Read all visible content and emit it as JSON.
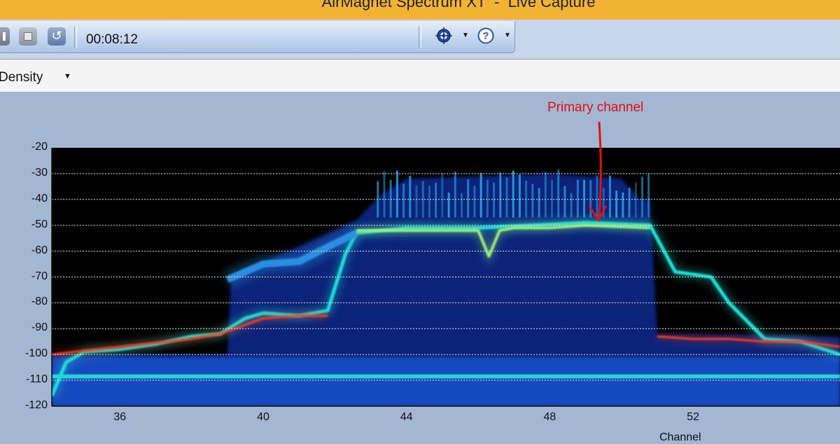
{
  "window": {
    "title": "AirMagnet Spectrum XT  -  Live Capture"
  },
  "toolbar": {
    "elapsed_time": "00:08:12",
    "buttons": [
      {
        "name": "pause-button",
        "icon": "pause-icon"
      },
      {
        "name": "stop-button",
        "icon": "stop-icon"
      },
      {
        "name": "refresh-button",
        "icon": "refresh-icon"
      },
      {
        "name": "locate-button",
        "icon": "crosshair-icon"
      },
      {
        "name": "help-button",
        "icon": "help-icon"
      }
    ]
  },
  "view": {
    "selected": "Density"
  },
  "annotation": {
    "label": "Primary channel",
    "color": "#e01010"
  },
  "colors": {
    "plot_bg": "#000000",
    "window_bg": "#a3b6d2",
    "titlebar": "#f2b233"
  },
  "chart_data": {
    "type": "heatmap",
    "title": "",
    "xlabel": "Channel",
    "ylabel": "",
    "x_ticks": [
      36,
      40,
      44,
      48,
      52
    ],
    "y_ticks": [
      -20,
      -30,
      -40,
      -50,
      -60,
      -70,
      -80,
      -90,
      -100,
      -110,
      -120
    ],
    "ylim": [
      -120,
      -20
    ],
    "grid": true,
    "x_range": [
      34.1,
      56.1
    ],
    "traces": [
      {
        "name": "noise-floor",
        "x": [
          34.1,
          36,
          38,
          40,
          42,
          44,
          46,
          48,
          50,
          52,
          54,
          56.1
        ],
        "y": [
          -108,
          -108,
          -108,
          -109,
          -108,
          -108,
          -108,
          -109,
          -108,
          -108,
          -108,
          -109
        ],
        "color": "#2fd0d0",
        "width": 16
      },
      {
        "name": "wide-band-edge",
        "x": [
          34.1,
          34.5,
          35,
          36,
          37,
          38,
          38.8,
          39.5,
          40,
          41,
          41.8,
          42.3,
          42.6,
          44,
          46,
          47.5,
          49,
          50.8,
          51.5,
          52.5,
          53,
          54,
          55,
          56.1
        ],
        "y": [
          -116,
          -103,
          -99,
          -98,
          -96,
          -93,
          -92,
          -86,
          -84,
          -85,
          -83,
          -61,
          -53,
          -51,
          -51,
          -50,
          -49,
          -50,
          -68,
          -70,
          -80,
          -94,
          -95,
          -100
        ],
        "color": "#1ee0d8",
        "width": 5
      },
      {
        "name": "adjacent-hump",
        "x": [
          39,
          40,
          41,
          42,
          42.6
        ],
        "y": [
          -71,
          -65,
          -64,
          -57,
          -53
        ],
        "color": "#2c8fe0",
        "width": 10
      },
      {
        "name": "primary-channel",
        "x": [
          42.6,
          44,
          46,
          46.3,
          46.6,
          47,
          48,
          49,
          50.8
        ],
        "y": [
          -52,
          -52,
          -52,
          -62,
          -52,
          -51,
          -51,
          -50,
          -51
        ],
        "color": "#9cf07a",
        "width": 4
      },
      {
        "name": "low-adjacent",
        "x": [
          34.1,
          36,
          38,
          38.8,
          39.4,
          40,
          41,
          41.8
        ],
        "y": [
          -100,
          -97,
          -94,
          -92,
          -89,
          -86,
          -85,
          -85
        ],
        "color": "#ff3a1a",
        "width": 3
      },
      {
        "name": "high-adjacent",
        "x": [
          51,
          52,
          53,
          54,
          55,
          56.1
        ],
        "y": [
          -93,
          -94,
          -94,
          -95,
          -95,
          -97
        ],
        "color": "#ff3a1a",
        "width": 3
      }
    ]
  }
}
